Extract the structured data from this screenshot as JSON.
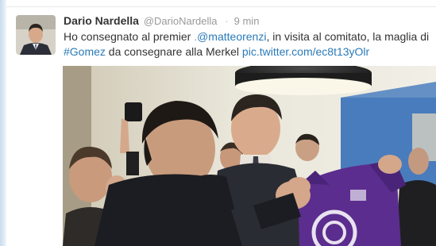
{
  "tweet": {
    "author_name": "Dario Nardella",
    "author_handle": "@DarioNardella",
    "separator": "·",
    "timestamp": "9 min",
    "text_prefix": "Ho consegnato al premier ",
    "mention_prefix": ".",
    "mention": "@matteorenzi",
    "text_mid": ", in visita al comitato, la maglia di",
    "hashtag": "#Gomez",
    "text_after_hashtag": " da consegnare alla Merkel ",
    "link": "pic.twitter.com/ec8t13yOlr"
  },
  "icons": {
    "avatar": "profile-photo",
    "photo": "attached-photo"
  },
  "colors": {
    "link": "#2a7ab8",
    "name": "#333333",
    "meta": "#999999",
    "jersey": "#5b2d8e"
  }
}
